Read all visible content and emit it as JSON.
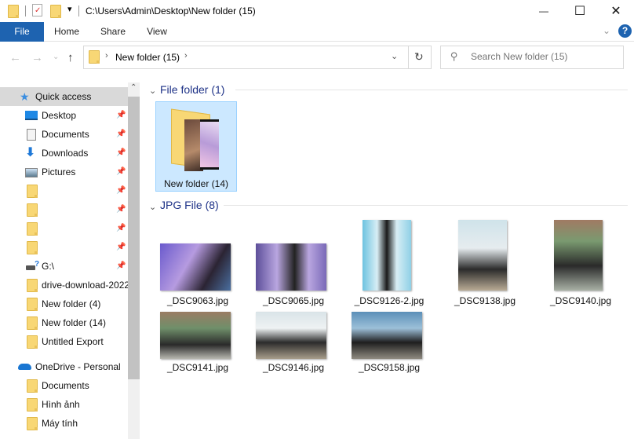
{
  "titlebar": {
    "path": "C:\\Users\\Admin\\Desktop\\New folder (15)",
    "qat_dropdown": "▾",
    "minimize": "—",
    "maximize": "☐",
    "close": "✕"
  },
  "ribbon": {
    "tabs": [
      {
        "label": "File",
        "active": true
      },
      {
        "label": "Home"
      },
      {
        "label": "Share"
      },
      {
        "label": "View"
      }
    ],
    "expand": "⌄",
    "help": "?"
  },
  "nav": {
    "back": "←",
    "forward": "→",
    "recent": "⌄",
    "up": "↑",
    "breadcrumb": [
      "New folder (15)"
    ],
    "refresh": "↻",
    "search_placeholder": "Search New folder (15)"
  },
  "sidebar": {
    "quick_access": "Quick access",
    "pinned": [
      {
        "label": "Desktop",
        "icon": "desktop-icon"
      },
      {
        "label": "Documents",
        "icon": "documents-icon"
      },
      {
        "label": "Downloads",
        "icon": "downloads-icon"
      },
      {
        "label": "Pictures",
        "icon": "pictures-icon"
      },
      {
        "label": "",
        "icon": "folder-icon"
      },
      {
        "label": "",
        "icon": "folder-icon"
      },
      {
        "label": "",
        "icon": "folder-icon"
      },
      {
        "label": "",
        "icon": "folder-icon"
      },
      {
        "label": "G:\\",
        "icon": "drive-icon"
      }
    ],
    "recent": [
      {
        "label": "drive-download-2022"
      },
      {
        "label": "New folder (4)"
      },
      {
        "label": "New folder (14)"
      },
      {
        "label": "Untitled Export"
      }
    ],
    "onedrive": "OneDrive - Personal",
    "onedrive_items": [
      {
        "label": "Documents"
      },
      {
        "label": "Hình ảnh"
      },
      {
        "label": "Máy tính"
      }
    ]
  },
  "content": {
    "groups": [
      {
        "title": "File folder (1)",
        "items": [
          {
            "name": "New folder (14)",
            "selected": true
          }
        ]
      },
      {
        "title": "JPG File (8)",
        "items": [
          {
            "name": "_DSC9063.jpg"
          },
          {
            "name": "_DSC9065.jpg"
          },
          {
            "name": "_DSC9126-2.jpg"
          },
          {
            "name": "_DSC9138.jpg"
          },
          {
            "name": "_DSC9140.jpg"
          },
          {
            "name": "_DSC9141.jpg"
          },
          {
            "name": "_DSC9146.jpg"
          },
          {
            "name": "_DSC9158.jpg"
          }
        ]
      }
    ]
  },
  "colors": {
    "accent": "#1e63b0",
    "selection": "#cce8ff",
    "group_header": "#1e3287"
  }
}
